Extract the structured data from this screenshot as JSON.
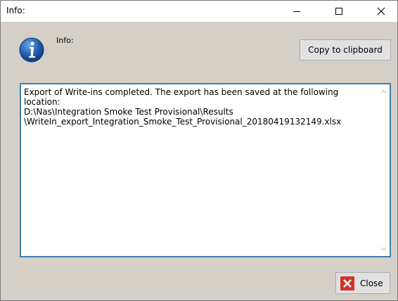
{
  "window": {
    "title": "Info:",
    "controls": {
      "minimize": "minimize-icon",
      "maximize": "maximize-icon",
      "close": "close-icon"
    }
  },
  "header": {
    "icon": "info-icon",
    "label": "Info:"
  },
  "copy_button": {
    "label": "Copy to clipboard"
  },
  "message": {
    "text": "Export of Write-ins completed. The export has been saved at the following location:\nD:\\Nas\\Integration Smoke Test Provisional\\Results\n\\WriteIn_export_Integration_Smoke_Test_Provisional_20180419132149.xlsx"
  },
  "close_button": {
    "label": "Close",
    "icon": "close-x-icon"
  },
  "colors": {
    "dialog_background": "#d4d0c8",
    "textarea_focus_border": "#3c7fb1",
    "close_icon_red": "#d3322a",
    "info_icon_blue": "#1f5fae"
  }
}
